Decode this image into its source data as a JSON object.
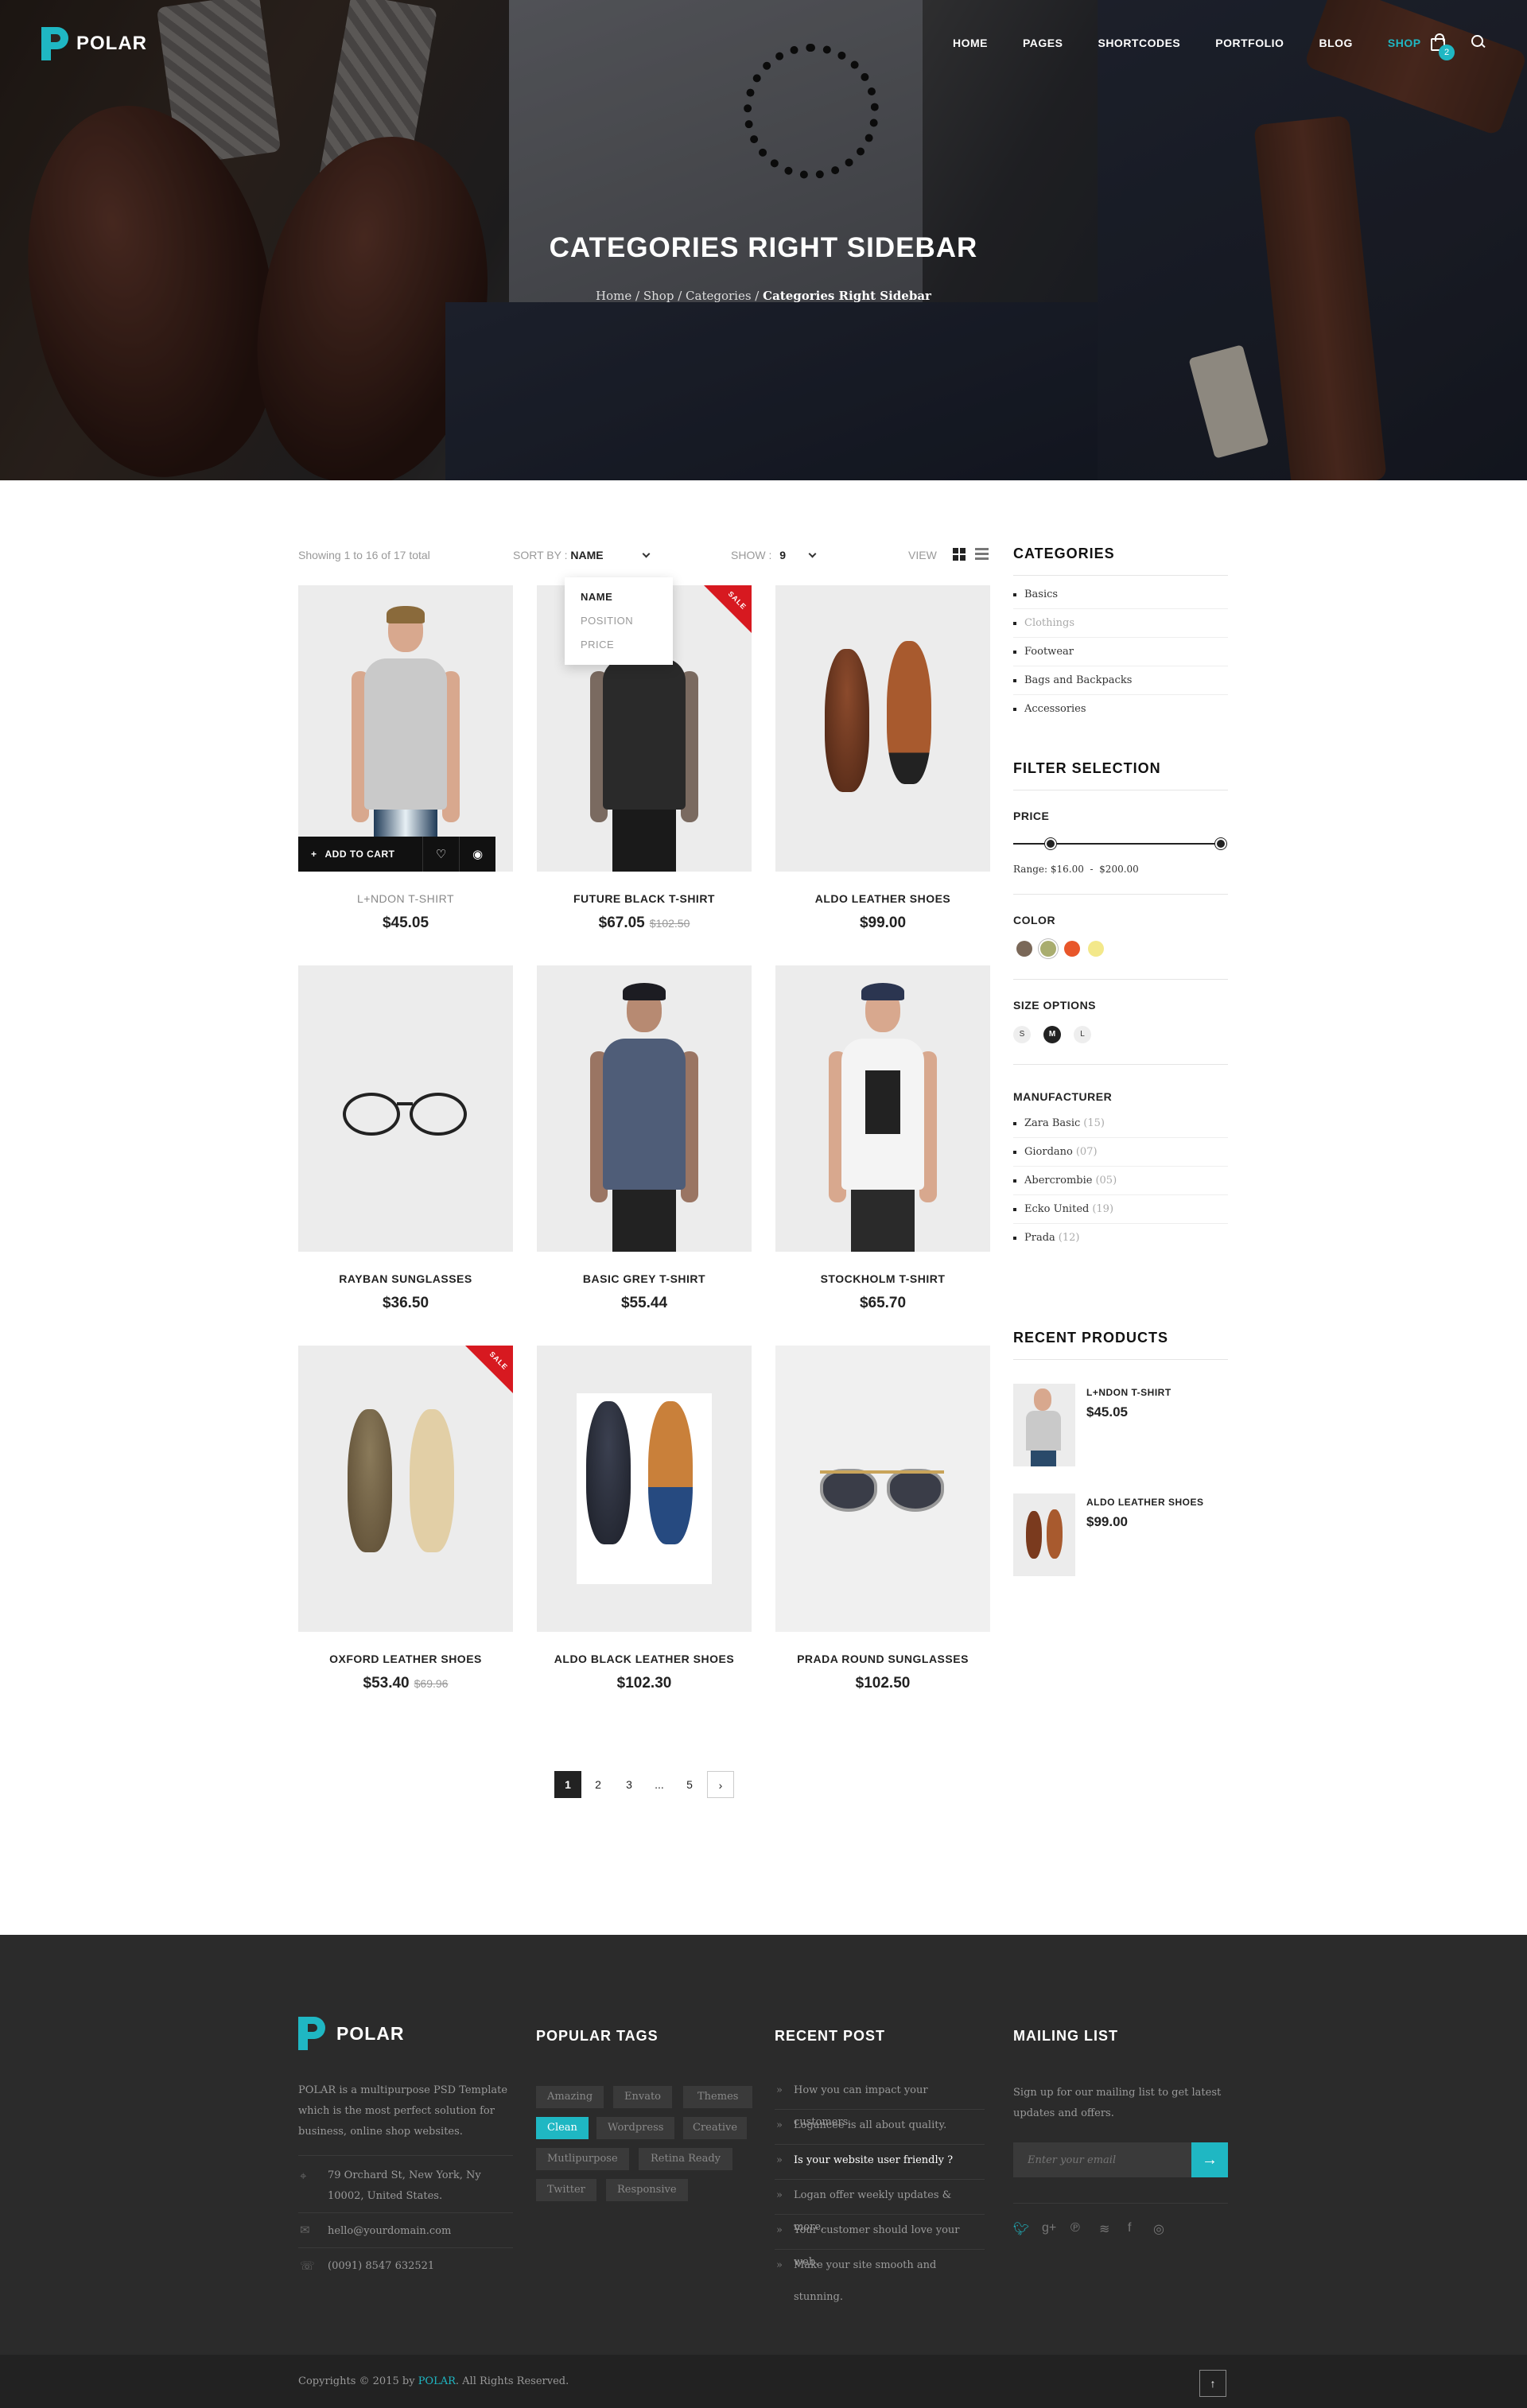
{
  "brand": {
    "name": "POLAR"
  },
  "nav": {
    "items": [
      "HOME",
      "PAGES",
      "SHORTCODES",
      "PORTFOLIO",
      "BLOG",
      "SHOP"
    ],
    "active": "SHOP",
    "cart_count": "2"
  },
  "hero": {
    "title": "CATEGORIES RIGHT SIDEBAR",
    "breadcrumb": [
      "Home",
      "Shop",
      "Categories"
    ],
    "breadcrumb_current": "Categories Right Sidebar"
  },
  "toolbar": {
    "showing": "Showing 1 to 16 of 17 total",
    "sort_label": "SORT BY :",
    "sort_value": "NAME",
    "show_label": "SHOW :",
    "show_value": "9",
    "view_label": "VIEW",
    "sort_options": [
      "NAME",
      "POSITION",
      "PRICE"
    ]
  },
  "products": [
    {
      "name": "L+NDON T-SHIRT",
      "price": "$45.05",
      "old_price": ""
    },
    {
      "name": "FUTURE BLACK T-SHIRT",
      "price": "$67.05",
      "old_price": "$102.50",
      "sale": "SALE"
    },
    {
      "name": "ALDO LEATHER SHOES",
      "price": "$99.00",
      "old_price": ""
    },
    {
      "name": "RAYBAN SUNGLASSES",
      "price": "$36.50",
      "old_price": ""
    },
    {
      "name": "BASIC GREY T-SHIRT",
      "price": "$55.44",
      "old_price": ""
    },
    {
      "name": "STOCKHOLM T-SHIRT",
      "price": "$65.70",
      "old_price": ""
    },
    {
      "name": "OXFORD LEATHER SHOES",
      "price": "$53.40",
      "old_price": "$69.96",
      "sale": "SALE"
    },
    {
      "name": "ALDO BLACK LEATHER SHOES",
      "price": "$102.30",
      "old_price": ""
    },
    {
      "name": "PRADA ROUND SUNGLASSES",
      "price": "$102.50",
      "old_price": ""
    }
  ],
  "quick": {
    "add_to_cart": "ADD TO CART"
  },
  "pagination": [
    "1",
    "2",
    "3",
    "...",
    "5"
  ],
  "sidebar": {
    "categories_title": "CATEGORIES",
    "categories": [
      "Basics",
      "Clothings",
      "Footwear",
      "Bags and Backpacks",
      "Accessories"
    ],
    "filter_title": "FILTER SELECTION",
    "price_label": "PRICE",
    "range_label": "Range:",
    "range_min": "$16.00",
    "range_max": "$200.00",
    "color_label": "COLOR",
    "colors": [
      "#7a6858",
      "#a9ad6f",
      "#e8562a",
      "#f3e88a"
    ],
    "size_label": "SIZE OPTIONS",
    "sizes": [
      "S",
      "M",
      "L"
    ],
    "size_selected": "M",
    "manufacturer_label": "MANUFACTURER",
    "manufacturers": [
      {
        "name": "Zara Basic",
        "count": "(15)"
      },
      {
        "name": "Giordano",
        "count": "(07)"
      },
      {
        "name": "Abercrombie",
        "count": "(05)"
      },
      {
        "name": "Ecko United",
        "count": "(19)"
      },
      {
        "name": "Prada",
        "count": "(12)"
      }
    ],
    "recent_title": "RECENT PRODUCTS",
    "recent": [
      {
        "name": "L+NDON T-SHIRT",
        "price": "$45.05"
      },
      {
        "name": "ALDO LEATHER SHOES",
        "price": "$99.00"
      }
    ]
  },
  "footer": {
    "about": "POLAR is a multipurpose PSD Template which is the most perfect solution for business, online shop websites.",
    "address": "79 Orchard St, New York, Ny 10002, United States.",
    "email": "hello@yourdomain.com",
    "phone": "(0091) 8547 632521",
    "tags_title": "POPULAR TAGS",
    "tags": [
      "Amazing",
      "Envato",
      "Themes",
      "Clean",
      "Wordpress",
      "Creative",
      "Mutlipurpose",
      "Retina Ready",
      "Twitter",
      "Responsive"
    ],
    "recent_title": "RECENT POST",
    "posts": [
      "How you can impact your customers.",
      "Logancee is all about quality.",
      "Is your website user friendly ?",
      "Logan offer weekly updates & more.",
      "Your customer should love your web.",
      "Make your site smooth and stunning."
    ],
    "mailing_title": "MAILING LIST",
    "mailing_text": "Sign up for our mailing list to get latest updates and offers.",
    "mailing_placeholder": "Enter your email",
    "copyright_pre": "Copyrights © 2015 by ",
    "copyright_brand": "POLAR",
    "copyright_post": ". All Rights Reserved."
  },
  "colors": {
    "accent": "#1fb7c3",
    "sale": "#d71920",
    "footer": "#2b2b2b"
  }
}
